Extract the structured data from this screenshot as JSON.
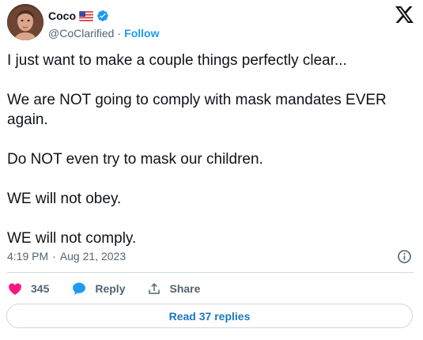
{
  "author": {
    "name": "Coco",
    "handle": "@CoClarified",
    "separator": "·",
    "follow_label": "Follow",
    "flag_icon": "us-flag-icon",
    "verified_icon": "verified-badge-icon"
  },
  "tweet": {
    "lines": [
      "I just want to make a couple things perfectly clear...",
      "We are NOT going to comply with mask mandates EVER again.",
      "Do NOT even try to mask our children.",
      "WE will not obey.",
      "WE will not comply."
    ]
  },
  "meta": {
    "time": "4:19 PM",
    "separator": "·",
    "date": "Aug 21, 2023"
  },
  "actions": {
    "likes_count": "345",
    "reply_label": "Reply",
    "share_label": "Share"
  },
  "read_replies_label": "Read 37 replies",
  "colors": {
    "accent": "#1d9bf0",
    "like": "#f91880",
    "text": "#0f1419",
    "muted": "#536471"
  }
}
